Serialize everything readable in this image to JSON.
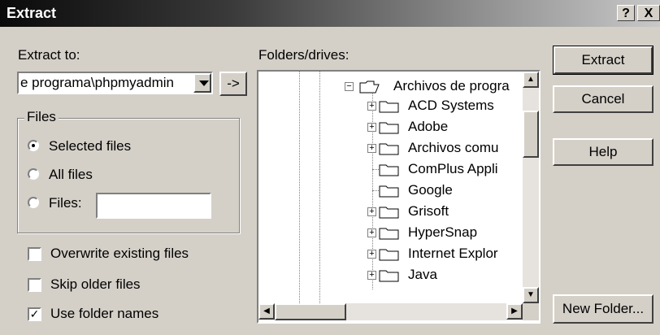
{
  "window": {
    "title": "Extract",
    "help_glyph": "?",
    "close_glyph": "X"
  },
  "extract_to": {
    "label": "Extract to:",
    "value": "e programa\\phpmyadmin",
    "browse_label": "->"
  },
  "files_group": {
    "title": "Files",
    "options": [
      {
        "label": "Selected files",
        "checked": true
      },
      {
        "label": "All files",
        "checked": false
      },
      {
        "label": "Files:",
        "checked": false
      }
    ],
    "files_input_value": ""
  },
  "options": [
    {
      "label": "Overwrite existing files",
      "checked": false
    },
    {
      "label": "Skip older files",
      "checked": false
    },
    {
      "label": "Use folder names",
      "checked": true
    }
  ],
  "folders": {
    "label": "Folders/drives:",
    "root": {
      "label": "Archivos de progra",
      "expanded": true
    },
    "children": [
      {
        "label": "ACD Systems",
        "expandable": true
      },
      {
        "label": "Adobe",
        "expandable": true
      },
      {
        "label": "Archivos comu",
        "expandable": true
      },
      {
        "label": "ComPlus Appli",
        "expandable": false
      },
      {
        "label": "Google",
        "expandable": false
      },
      {
        "label": "Grisoft",
        "expandable": true
      },
      {
        "label": "HyperSnap",
        "expandable": true
      },
      {
        "label": "Internet Explor",
        "expandable": true
      },
      {
        "label": "Java",
        "expandable": true
      }
    ]
  },
  "buttons": {
    "extract": "Extract",
    "cancel": "Cancel",
    "help": "Help",
    "new_folder": "New Folder..."
  },
  "colors": {
    "dialog_bg": "#d4d0c8",
    "title_gradient_start": "#0a0a0a",
    "title_gradient_end": "#c8c8c8"
  }
}
